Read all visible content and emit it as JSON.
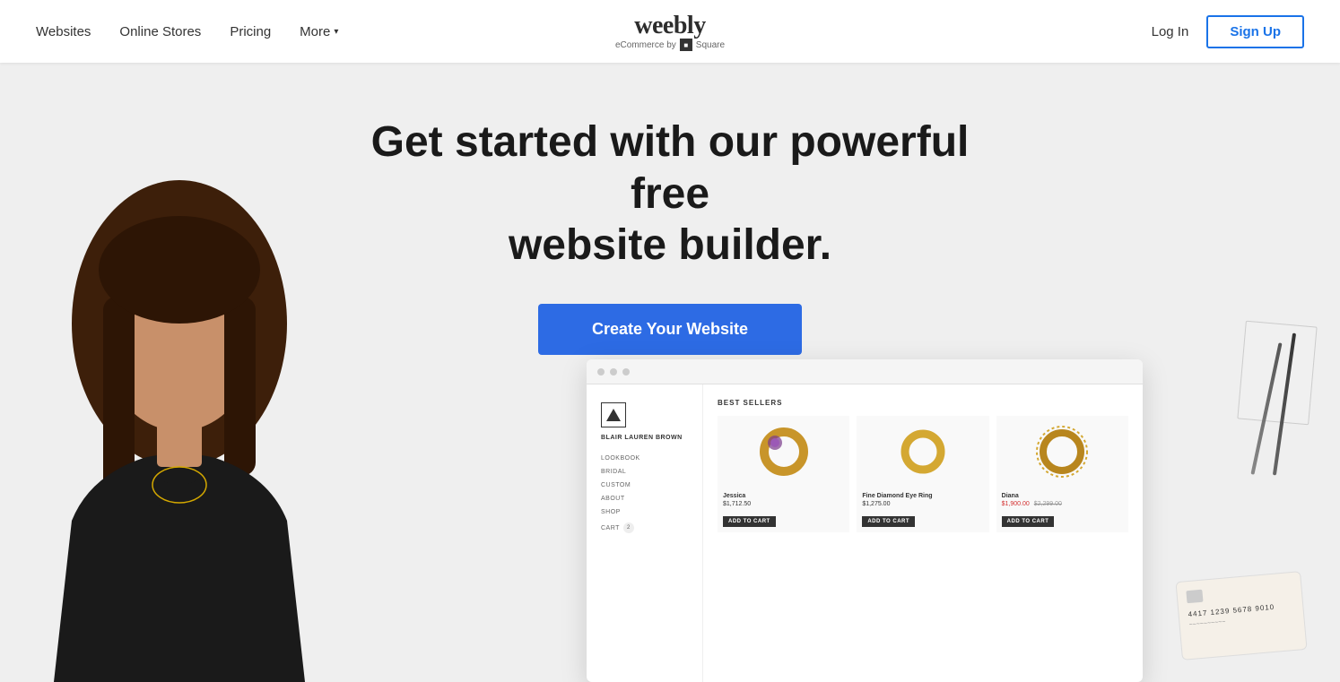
{
  "nav": {
    "links": [
      {
        "id": "websites",
        "label": "Websites"
      },
      {
        "id": "online-stores",
        "label": "Online Stores"
      },
      {
        "id": "pricing",
        "label": "Pricing"
      },
      {
        "id": "more",
        "label": "More"
      }
    ],
    "logo": {
      "text": "weebly",
      "subtext": "eCommerce by",
      "square_label": "■",
      "square_brand": "Square"
    },
    "login_label": "Log In",
    "signup_label": "Sign Up"
  },
  "hero": {
    "title_line1": "Get started with our powerful free",
    "title_line2": "website builder.",
    "cta_label": "Create Your Website"
  },
  "mockup": {
    "titlebar_dots": [
      "dot1",
      "dot2",
      "dot3"
    ],
    "sidebar": {
      "brand": "BLAIR LAUREN BROWN",
      "menu_items": [
        "LOOKBOOK",
        "BRIDAL",
        "CUSTOM",
        "ABOUT",
        "SHOP"
      ],
      "cart_label": "CART",
      "cart_count": "2"
    },
    "main": {
      "section_label": "BEST SELLERS",
      "products": [
        {
          "name": "Jessica",
          "price": "$1,712.50",
          "sale_price": null,
          "original_price": null,
          "btn_label": "ADD TO CART",
          "ring_color": "#c8952a"
        },
        {
          "name": "Fine Diamond Eye Ring",
          "price": "$1,275.00",
          "sale_price": null,
          "original_price": null,
          "btn_label": "ADD TO CART",
          "ring_color": "#d4a832"
        },
        {
          "name": "Diana",
          "price": "$1,900.00",
          "sale_price": "$1,900.00",
          "original_price": "$2,299.00",
          "btn_label": "ADD TO CART",
          "ring_color": "#b8861e"
        }
      ]
    }
  },
  "deco": {
    "card_number": "4417 1239 5678 9010",
    "card_squiggle": "~~~~~~~~~~"
  }
}
